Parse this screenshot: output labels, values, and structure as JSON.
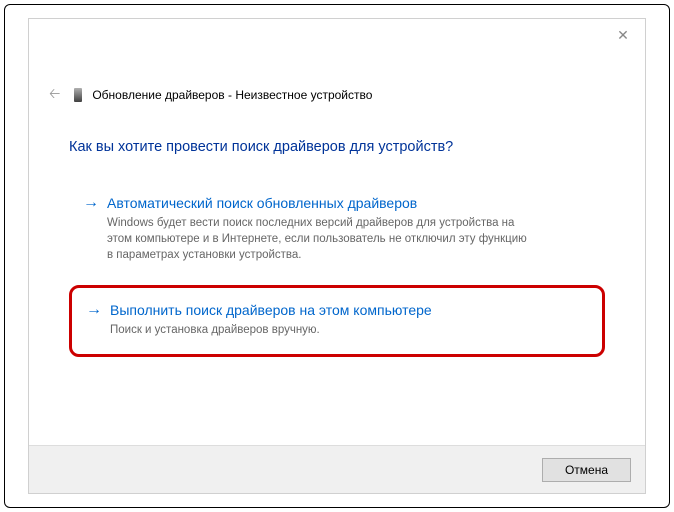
{
  "header": {
    "title": "Обновление драйверов - Неизвестное устройство"
  },
  "main": {
    "heading": "Как вы хотите провести поиск драйверов для устройств?",
    "options": [
      {
        "title": "Автоматический поиск обновленных драйверов",
        "description": "Windows будет вести поиск последних версий драйверов для устройства на этом компьютере и в Интернете, если пользователь не отключил эту функцию в параметрах установки устройства."
      },
      {
        "title": "Выполнить поиск драйверов на этом компьютере",
        "description": "Поиск и установка драйверов вручную."
      }
    ]
  },
  "footer": {
    "cancel": "Отмена"
  }
}
